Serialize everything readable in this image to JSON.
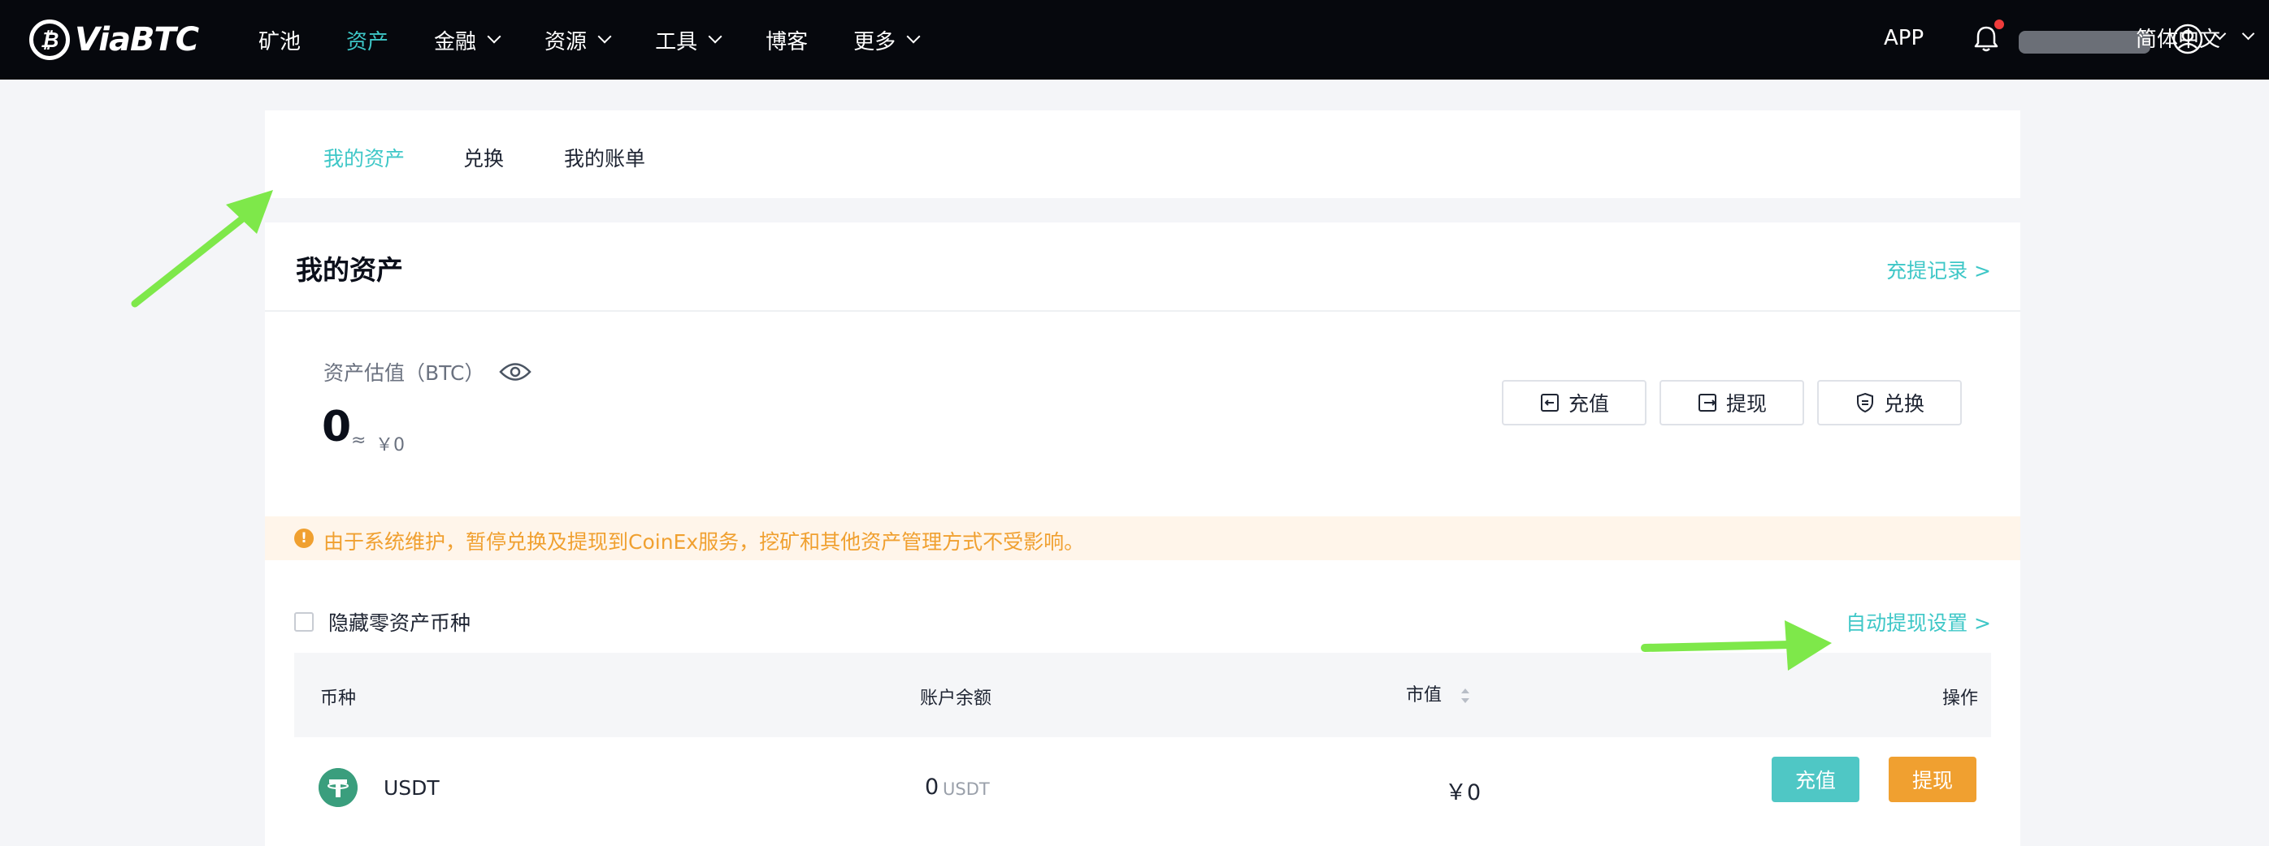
{
  "header": {
    "logo_text": "ViaBTC",
    "nav": [
      {
        "label": "矿池"
      },
      {
        "label": "资产"
      },
      {
        "label": "金融"
      },
      {
        "label": "资源"
      },
      {
        "label": "工具"
      },
      {
        "label": "博客"
      },
      {
        "label": "更多"
      }
    ],
    "app_label": "APP",
    "language": "简体中文"
  },
  "tabs": [
    "我的资产",
    "兑换",
    "我的账单"
  ],
  "assets": {
    "title": "我的资产",
    "record_link": "充提记录 >",
    "estimate_label": "资产估值（BTC）",
    "estimate_value": "0",
    "approx": "≈",
    "estimate_cny": "￥0",
    "actions": {
      "deposit": "充值",
      "withdraw": "提现",
      "exchange": "兑换"
    }
  },
  "notice": {
    "text": "由于系统维护，暂停兑换及提现到CoinEx服务，挖矿和其他资产管理方式不受影响。"
  },
  "filters": {
    "hide_zero": "隐藏零资产币种",
    "auto_withdraw": "自动提现设置 >"
  },
  "table": {
    "columns": {
      "coin": "币种",
      "balance": "账户余额",
      "market": "市值",
      "action": "操作"
    },
    "rows": [
      {
        "coin": "USDT",
        "balance": "0",
        "unit": "USDT",
        "market": "￥0",
        "deposit": "充值",
        "withdraw": "提现"
      }
    ]
  },
  "colors": {
    "accent": "#3ec7c7",
    "warning": "#f0a030",
    "arrow": "#7ee84a"
  }
}
